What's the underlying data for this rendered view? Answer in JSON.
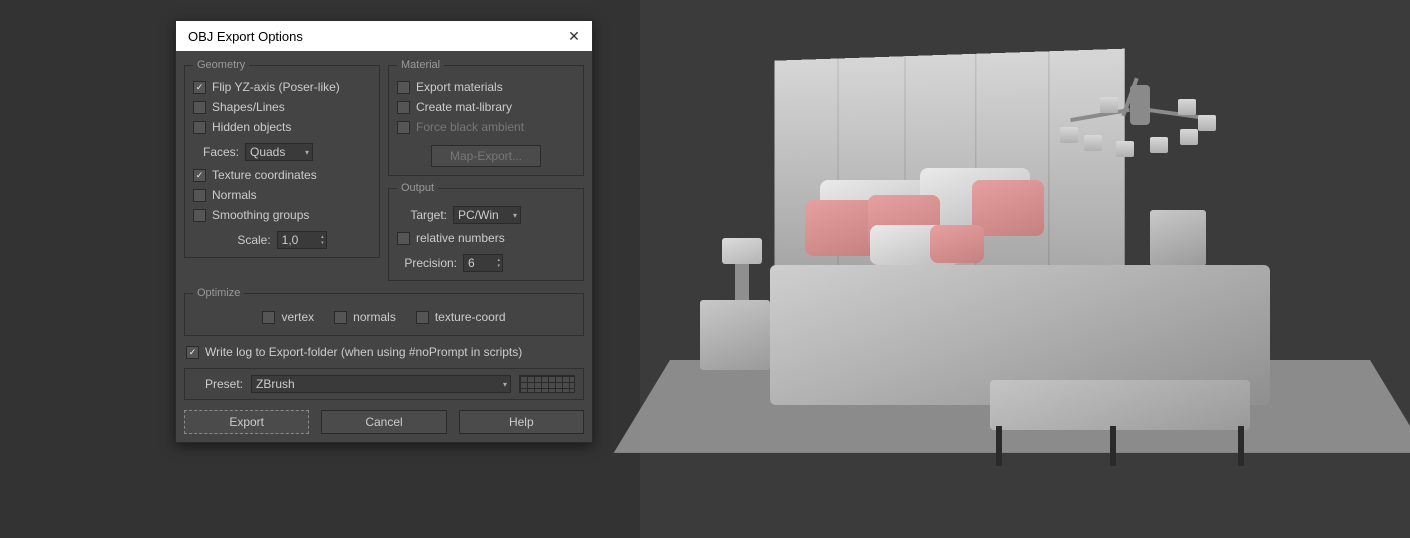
{
  "dialog": {
    "title": "OBJ Export Options",
    "geometry": {
      "legend": "Geometry",
      "flip_yz": "Flip YZ-axis (Poser-like)",
      "shapes": "Shapes/Lines",
      "hidden": "Hidden objects",
      "faces_label": "Faces:",
      "faces_value": "Quads",
      "tex_coords": "Texture coordinates",
      "normals": "Normals",
      "smoothing": "Smoothing groups",
      "scale_label": "Scale:",
      "scale_value": "1,0"
    },
    "material": {
      "legend": "Material",
      "export_mat": "Export materials",
      "create_lib": "Create mat-library",
      "force_black": "Force black ambient",
      "map_export": "Map-Export..."
    },
    "output": {
      "legend": "Output",
      "target_label": "Target:",
      "target_value": "PC/Win",
      "relative": "relative numbers",
      "precision_label": "Precision:",
      "precision_value": "6"
    },
    "optimize": {
      "legend": "Optimize",
      "vertex": "vertex",
      "normals": "normals",
      "texcoord": "texture-coord"
    },
    "write_log": "Write log to Export-folder (when using #noPrompt in scripts)",
    "preset": {
      "label": "Preset:",
      "value": "ZBrush"
    },
    "buttons": {
      "export": "Export",
      "cancel": "Cancel",
      "help": "Help"
    }
  }
}
